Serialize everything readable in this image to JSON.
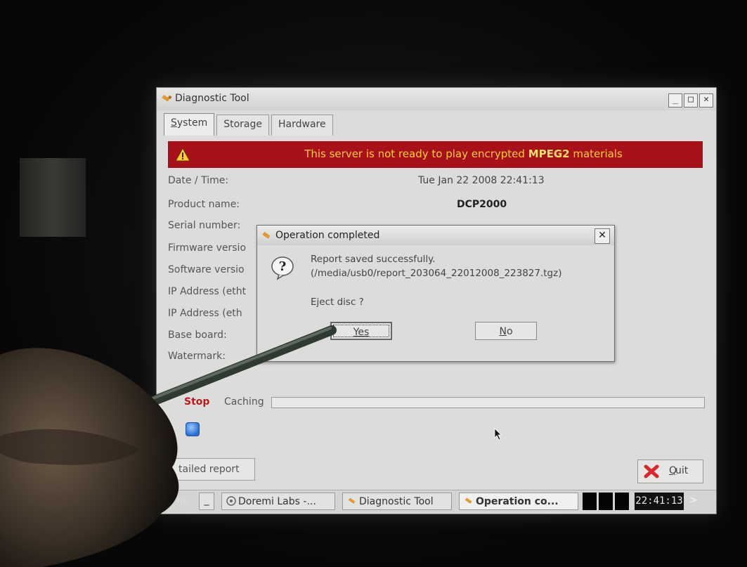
{
  "window": {
    "title": "Diagnostic Tool",
    "controls": [
      "_",
      "□",
      "✕"
    ]
  },
  "tabs": [
    {
      "label_first": "S",
      "label_rest": "ystem",
      "active": true
    },
    {
      "label": "Storage",
      "active": false
    },
    {
      "label": "Hardware",
      "active": false
    }
  ],
  "banner": {
    "text_before": "This server is not ready to play encrypted ",
    "text_bold": "MPEG2",
    "text_after": " materials",
    "color": "#a8111a",
    "text_color": "#ffcf3a"
  },
  "info_rows": [
    {
      "label": "Date / Time:",
      "value": "Tue Jan 22 2008 22:41:13"
    },
    {
      "label": "Product name:",
      "value": "DCP2000"
    },
    {
      "label": "Serial number:",
      "value": ""
    },
    {
      "label": "Firmware versio",
      "value": ""
    },
    {
      "label": "Software versio",
      "value": ""
    },
    {
      "label": "IP Address (etht",
      "value": ""
    },
    {
      "label": "IP Address (eth",
      "value": ""
    },
    {
      "label": "Base board:",
      "value": ""
    },
    {
      "label": "Watermark:",
      "value": ""
    }
  ],
  "caching": {
    "stop_label": "Stop",
    "label": "Caching",
    "progress": 0
  },
  "buttons": {
    "report": "tailed report",
    "quit_first": "Q",
    "quit_rest": "uit"
  },
  "dialog": {
    "title": "Operation completed",
    "close": "✕",
    "message_line1": "Report saved successfully.",
    "message_line2": "(/media/usb0/report_203064_22012008_223827.tgz)",
    "question": "Eject disc ?",
    "yes": "Yes",
    "no_first": "N",
    "no_rest": "o"
  },
  "taskbar": {
    "menu": "nu",
    "minimize": "_",
    "items": [
      "Doremi Labs -...",
      "Diagnostic Tool",
      "Operation co..."
    ],
    "clock": "22:41:13",
    "more": ">"
  }
}
